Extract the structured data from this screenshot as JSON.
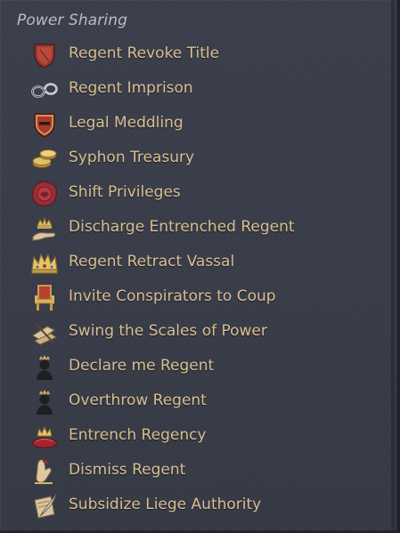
{
  "panel": {
    "header": "Power Sharing",
    "items": [
      {
        "label": "Regent Revoke Title",
        "icon": "shield-icon"
      },
      {
        "label": "Regent Imprison",
        "icon": "shackles-icon"
      },
      {
        "label": "Legal Meddling",
        "icon": "crest-shield-icon"
      },
      {
        "label": "Syphon Treasury",
        "icon": "coins-icon"
      },
      {
        "label": "Shift Privileges",
        "icon": "wax-seal-icon"
      },
      {
        "label": "Discharge Entrenched Regent",
        "icon": "crown-hand-icon"
      },
      {
        "label": "Regent Retract Vassal",
        "icon": "crown-icon"
      },
      {
        "label": "Invite Conspirators to Coup",
        "icon": "throne-icon"
      },
      {
        "label": "Swing the Scales of Power",
        "icon": "scroll-quill-icon"
      },
      {
        "label": "Declare me Regent",
        "icon": "crowned-bust-icon"
      },
      {
        "label": "Overthrow Regent",
        "icon": "crowned-bust-icon"
      },
      {
        "label": "Entrench Regency",
        "icon": "crown-cushion-icon"
      },
      {
        "label": "Dismiss Regent",
        "icon": "hand-gesture-icon"
      },
      {
        "label": "Subsidize Liege Authority",
        "icon": "quill-scroll-icon"
      }
    ]
  }
}
